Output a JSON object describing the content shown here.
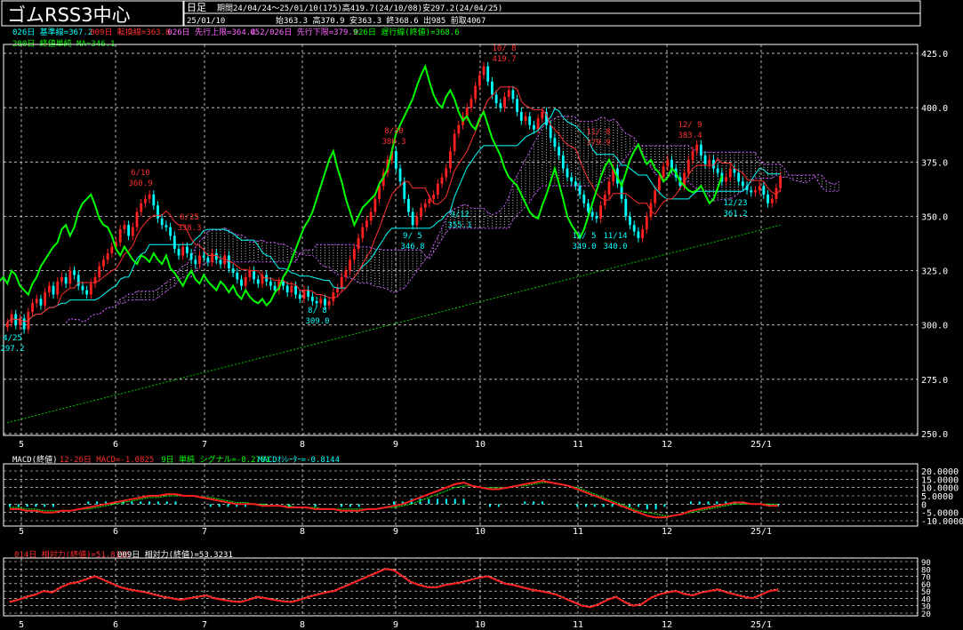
{
  "header": {
    "title": "ゴムRSS3中心",
    "period_label": "日足",
    "period_info": "期間24/04/24～25/01/10(175)高419.7(24/10/08)安297.2(24/04/25)",
    "date": "25/01/10",
    "ohlc_info": "始363.3 高370.9 安363.3 終368.6 出985 前取4067"
  },
  "legend": [
    {
      "text": "026日 基準線=367.2",
      "color": "#00ffff"
    },
    {
      "text": "009日 転換線=363.8",
      "color": "#ff3030"
    },
    {
      "text": "026日 先行上限=364.4",
      "color": "#ff66ff"
    },
    {
      "text": "052/026日 先行下限=379.9",
      "color": "#ff66ff"
    },
    {
      "text": "026日 遅行線(終値)=368.6",
      "color": "#00ff00"
    },
    {
      "text": "200日 終値単純 MA=346.1",
      "color": "#00ff00"
    }
  ],
  "macd_legend": [
    {
      "text": "MACD(終値)",
      "color": "#ffffff"
    },
    {
      "text": "12-26日 MACD=-1.0825",
      "color": "#ff3030"
    },
    {
      "text": "9日 単純 シグナル=-0.2781",
      "color": "#00ff00"
    },
    {
      "text": "MACDｵｼﾚｰﾀｰ=-0.8144",
      "color": "#00ffff"
    }
  ],
  "rsi_legend": [
    {
      "text": "014日 相対力(終値)=51.8196",
      "color": "#ff3030"
    },
    {
      "text": "009日 相対力(終値)=53.3231",
      "color": "#ffffff"
    }
  ],
  "main_yticks": [
    "425.0",
    "400.0",
    "375.0",
    "350.0",
    "325.0",
    "300.0",
    "275.0",
    "250.0"
  ],
  "macd_yticks": [
    "20.0000",
    "15.0000",
    "10.0000",
    "5.0000",
    "0",
    "-5.0000",
    "-10.0000"
  ],
  "rsi_yticks": [
    "90",
    "80",
    "70",
    "60",
    "50",
    "40",
    "30",
    "20"
  ],
  "month_labels": [
    "5",
    "6",
    "7",
    "8",
    "9",
    "10",
    "11",
    "12",
    "25/1"
  ],
  "annotations": [
    {
      "date": "4/25",
      "value": "297.2",
      "color": "#00ffff"
    },
    {
      "date": "6/10",
      "value": "360.9",
      "color": "#ff3030"
    },
    {
      "date": "6/25",
      "value": "338.3",
      "color": "#ff3030"
    },
    {
      "date": "8/ 8",
      "value": "309.0",
      "color": "#00ffff"
    },
    {
      "date": "8/30",
      "value": "380.3",
      "color": "#ff3030"
    },
    {
      "date": "9/ 5",
      "value": "346.8",
      "color": "#00ffff"
    },
    {
      "date": "9/12",
      "value": "355.1",
      "color": "#00ffff"
    },
    {
      "date": "10/ 8",
      "value": "419.7",
      "color": "#ff3030"
    },
    {
      "date": "11/ 8",
      "value": "379.9",
      "color": "#ff3030"
    },
    {
      "date": "11/ 5",
      "value": "349.0",
      "color": "#00ffff"
    },
    {
      "date": "11/14",
      "value": "340.0",
      "color": "#00ffff"
    },
    {
      "date": "12/ 9",
      "value": "383.4",
      "color": "#ff3030"
    },
    {
      "date": "12/23",
      "value": "361.2",
      "color": "#00ffff"
    }
  ],
  "colors": {
    "up": "#ff2020",
    "down": "#00ffff",
    "kijun": "#00ffff",
    "tenkan": "#ff3030",
    "span": "#cc55ff",
    "chikou": "#00ff00",
    "ma": "#00cc00",
    "macd": "#ff2020",
    "signal": "#00ff00",
    "osc": "#00ffff",
    "grid": "#ffffff"
  },
  "chart_data": {
    "type": "candlestick",
    "ylim_main": [
      250,
      425
    ],
    "ylim_macd": [
      -10,
      20
    ],
    "ylim_rsi": [
      20,
      90
    ],
    "closes": [
      301,
      305,
      300,
      303,
      298,
      306,
      310,
      312,
      309,
      315,
      318,
      314,
      320,
      322,
      319,
      325,
      323,
      318,
      316,
      314,
      319,
      322,
      327,
      330,
      333,
      336,
      338,
      344,
      346,
      341,
      345,
      352,
      356,
      358,
      360,
      355,
      349,
      346,
      345,
      341,
      335,
      332,
      336,
      333,
      330,
      328,
      332,
      331,
      329,
      333,
      330,
      328,
      332,
      326,
      324,
      321,
      318,
      322,
      325,
      321,
      319,
      323,
      320,
      318,
      316,
      320,
      318,
      315,
      318,
      314,
      312,
      316,
      313,
      311,
      310,
      312,
      309,
      311,
      315,
      317,
      322,
      325,
      330,
      335,
      340,
      345,
      348,
      352,
      358,
      364,
      370,
      376,
      380,
      372,
      366,
      358,
      352,
      346,
      350,
      354,
      356,
      358,
      360,
      365,
      368,
      372,
      380,
      388,
      392,
      396,
      400,
      404,
      410,
      415,
      419,
      412,
      406,
      402,
      400,
      405,
      408,
      404,
      398,
      394,
      396,
      392,
      390,
      395,
      398,
      392,
      386,
      382,
      378,
      372,
      368,
      366,
      364,
      360,
      356,
      352,
      350,
      349,
      355,
      360,
      366,
      372,
      365,
      358,
      350,
      346,
      343,
      340,
      344,
      350,
      356,
      362,
      368,
      373,
      376,
      372,
      368,
      364,
      370,
      376,
      380,
      383,
      378,
      374,
      376,
      372,
      370,
      366,
      368,
      372,
      370,
      366,
      364,
      362,
      361,
      362,
      364,
      360,
      356,
      358,
      363,
      368.6
    ],
    "macd": [
      -3,
      -3,
      -4,
      -4,
      -5,
      -5,
      -4,
      -4,
      -3,
      -2,
      -1,
      0,
      1,
      2,
      3,
      4,
      5,
      5,
      6,
      6,
      5,
      5,
      4,
      3,
      2,
      1,
      0,
      0,
      0,
      -1,
      -1,
      -1,
      -2,
      -2,
      -2,
      -3,
      -3,
      -3,
      -4,
      -4,
      -4,
      -3,
      -3,
      -2,
      -1,
      0,
      2,
      4,
      6,
      8,
      10,
      12,
      13,
      11,
      10,
      9,
      9,
      10,
      11,
      12,
      13,
      14,
      13,
      12,
      11,
      9,
      7,
      5,
      3,
      1,
      -1,
      -3,
      -5,
      -7,
      -8,
      -8,
      -7,
      -6,
      -4,
      -3,
      -2,
      -1,
      0,
      1,
      1,
      0,
      0,
      -1,
      -1.08
    ],
    "signal": [
      -2,
      -2,
      -3,
      -3,
      -4,
      -4,
      -4,
      -4,
      -3,
      -3,
      -2,
      -1,
      0,
      1,
      2,
      3,
      4,
      4,
      5,
      5,
      5,
      5,
      4,
      4,
      3,
      2,
      1,
      1,
      0,
      0,
      -1,
      -1,
      -1,
      -2,
      -2,
      -2,
      -3,
      -3,
      -3,
      -3,
      -3,
      -3,
      -3,
      -2,
      -2,
      -1,
      0,
      2,
      4,
      6,
      8,
      10,
      11,
      11,
      10,
      10,
      10,
      10,
      11,
      11,
      12,
      13,
      13,
      12,
      11,
      10,
      8,
      6,
      4,
      2,
      0,
      -2,
      -4,
      -5,
      -6,
      -7,
      -7,
      -6,
      -5,
      -4,
      -3,
      -2,
      -1,
      0,
      0,
      0,
      0,
      0,
      -0.28
    ],
    "rsi": [
      35,
      38,
      42,
      45,
      50,
      48,
      55,
      60,
      62,
      66,
      70,
      65,
      60,
      55,
      52,
      50,
      48,
      45,
      42,
      40,
      38,
      40,
      42,
      44,
      40,
      38,
      36,
      35,
      38,
      42,
      40,
      38,
      36,
      35,
      38,
      42,
      45,
      48,
      50,
      55,
      60,
      65,
      70,
      75,
      80,
      78,
      70,
      62,
      58,
      55,
      55,
      58,
      60,
      62,
      65,
      68,
      70,
      65,
      60,
      58,
      55,
      52,
      50,
      48,
      45,
      40,
      35,
      30,
      28,
      32,
      38,
      42,
      35,
      30,
      32,
      40,
      45,
      48,
      50,
      46,
      44,
      48,
      50,
      52,
      48,
      45,
      42,
      40,
      45,
      50,
      51.8
    ]
  }
}
